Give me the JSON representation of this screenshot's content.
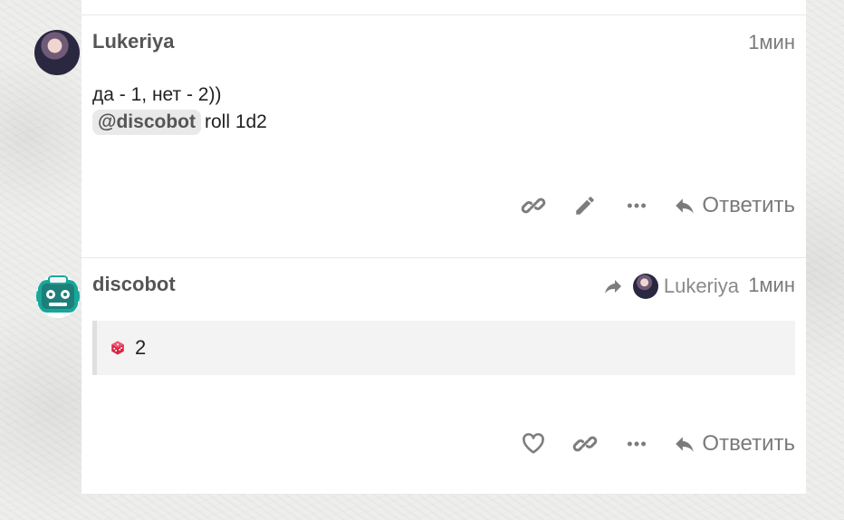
{
  "post1": {
    "username": "Lukeriya",
    "time": "1мин",
    "line1": "да - 1, нет - 2))",
    "mention": "@discobot",
    "line2_rest": "roll 1d2",
    "actions": {
      "link_icon": "link-icon",
      "edit_icon": "pencil-icon",
      "more_icon": "more-icon",
      "reply_label": "Ответить"
    }
  },
  "post2": {
    "username": "discobot",
    "reply_to": "Lukeriya",
    "time": "1мин",
    "quote_value": "2",
    "actions": {
      "like_icon": "heart-icon",
      "link_icon": "link-icon",
      "more_icon": "more-icon",
      "reply_label": "Ответить"
    }
  },
  "colors": {
    "text_muted": "#7d7d7d",
    "text_primary": "#222222",
    "mention_bg": "#e9e9e9",
    "quote_bg": "#f3f3f3",
    "discobot_teal": "#16a79b",
    "dice_red": "#d72644"
  }
}
